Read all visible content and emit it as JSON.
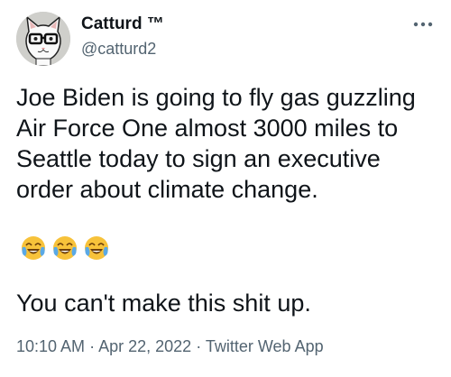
{
  "tweet": {
    "author": {
      "display_name": "Catturd ™",
      "handle": "@catturd2",
      "avatar_icon": "cat-with-glasses-avatar"
    },
    "more_icon": "more-options-icon",
    "text_main": "Joe Biden is going to fly gas guzzling\nAir Force One almost 3000 miles to\nSeattle today to sign an executive\norder about climate change.",
    "emojis": [
      "face-with-tears-of-joy",
      "face-with-tears-of-joy",
      "face-with-tears-of-joy"
    ],
    "text_secondary": "You can't make this shit up.",
    "meta": {
      "time": "10:10 AM",
      "separator": "·",
      "date": "Apr 22, 2022",
      "source": "Twitter Web App"
    }
  },
  "colors": {
    "text_primary": "#0f1419",
    "text_secondary": "#536471",
    "emoji_face": "#f7c23a",
    "emoji_tears": "#5aa9e6"
  }
}
